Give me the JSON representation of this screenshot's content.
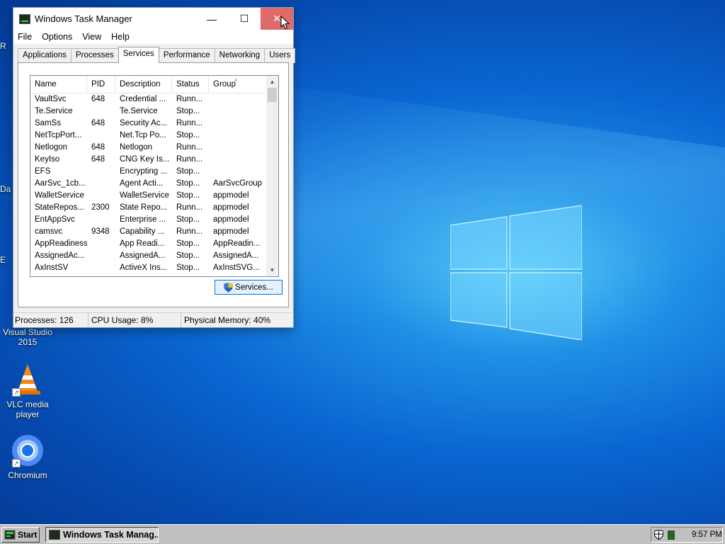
{
  "desktop": {
    "icons": [
      {
        "label": "Visual Studio 2015",
        "line1": "Visual Studio",
        "line2": "2015"
      },
      {
        "label": "VLC media player",
        "line1": "VLC media",
        "line2": "player"
      },
      {
        "label": "Chromium",
        "line1": "Chromium",
        "line2": ""
      }
    ],
    "clipped_labels": [
      "R",
      "Da",
      "E"
    ]
  },
  "window": {
    "title": "Windows Task Manager",
    "controls": {
      "minimize": "—",
      "maximize": "☐",
      "close": "✕"
    },
    "menu": [
      "File",
      "Options",
      "View",
      "Help"
    ],
    "tabs": [
      "Applications",
      "Processes",
      "Services",
      "Performance",
      "Networking",
      "Users"
    ],
    "active_tab": "Services",
    "columns": [
      "Name",
      "PID",
      "Description",
      "Status",
      "Group"
    ],
    "rows": [
      {
        "name": "VaultSvc",
        "pid": "648",
        "description": "Credential ...",
        "status": "Runn...",
        "group": ""
      },
      {
        "name": "Te.Service",
        "pid": "",
        "description": "Te.Service",
        "status": "Stop...",
        "group": ""
      },
      {
        "name": "SamSs",
        "pid": "648",
        "description": "Security Ac...",
        "status": "Runn...",
        "group": ""
      },
      {
        "name": "NetTcpPort...",
        "pid": "",
        "description": "Net.Tcp Po...",
        "status": "Stop...",
        "group": ""
      },
      {
        "name": "Netlogon",
        "pid": "648",
        "description": "Netlogon",
        "status": "Runn...",
        "group": ""
      },
      {
        "name": "KeyIso",
        "pid": "648",
        "description": "CNG Key Is...",
        "status": "Runn...",
        "group": ""
      },
      {
        "name": "EFS",
        "pid": "",
        "description": "Encrypting ...",
        "status": "Stop...",
        "group": ""
      },
      {
        "name": "AarSvc_1cb...",
        "pid": "",
        "description": "Agent Acti...",
        "status": "Stop...",
        "group": "AarSvcGroup"
      },
      {
        "name": "WalletService",
        "pid": "",
        "description": "WalletService",
        "status": "Stop...",
        "group": "appmodel"
      },
      {
        "name": "StateRepos...",
        "pid": "2300",
        "description": "State Repo...",
        "status": "Runn...",
        "group": "appmodel"
      },
      {
        "name": "EntAppSvc",
        "pid": "",
        "description": "Enterprise ...",
        "status": "Stop...",
        "group": "appmodel"
      },
      {
        "name": "camsvc",
        "pid": "9348",
        "description": "Capability ...",
        "status": "Runn...",
        "group": "appmodel"
      },
      {
        "name": "AppReadiness",
        "pid": "",
        "description": "App Readi...",
        "status": "Stop...",
        "group": "AppReadin..."
      },
      {
        "name": "AssignedAc...",
        "pid": "",
        "description": "AssignedA...",
        "status": "Stop...",
        "group": "AssignedA..."
      },
      {
        "name": "AxInstSV",
        "pid": "",
        "description": "ActiveX Ins...",
        "status": "Stop...",
        "group": "AxInstSVG..."
      }
    ],
    "services_button": "Services...",
    "status": {
      "processes": "Processes: 126",
      "cpu": "CPU Usage: 8%",
      "memory": "Physical Memory: 40%"
    }
  },
  "taskbar": {
    "start_label": "Start",
    "task_label": "Windows Task Manag...",
    "clock": "9:57 PM"
  },
  "colors": {
    "close_button": "#e06a6a",
    "desktop_blue": "#0a66d1",
    "taskbar": "#c0c0c0"
  },
  "icons": [
    "task-manager-icon",
    "shield-icon",
    "vlc-cone-icon",
    "chromium-icon",
    "windows-logo-icon",
    "cursor-arrow-icon"
  ]
}
